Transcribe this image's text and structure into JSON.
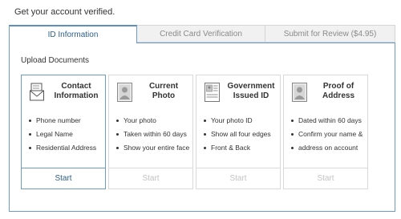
{
  "page_title": "Get your account verified.",
  "tabs": [
    {
      "label": "ID Information",
      "active": true
    },
    {
      "label": "Credit Card Verification",
      "active": false
    },
    {
      "label": "Submit for Review ($4.95)",
      "active": false
    }
  ],
  "section_label": "Upload Documents",
  "cards": [
    {
      "title": "Contact Information",
      "icon": "envelope-icon",
      "items": [
        "Phone number",
        "Legal Name",
        "Residential Address"
      ],
      "action": "Start",
      "enabled": true
    },
    {
      "title": "Current Photo",
      "icon": "portrait-photo-icon",
      "items": [
        "Your photo",
        "Taken within 60 days",
        "Show your entire face"
      ],
      "action": "Start",
      "enabled": false
    },
    {
      "title": "Government Issued ID",
      "icon": "id-card-icon",
      "items": [
        "Your photo ID",
        "Show all four edges",
        "Front & Back"
      ],
      "action": "Start",
      "enabled": false
    },
    {
      "title": "Proof of Address",
      "icon": "address-document-icon",
      "items": [
        "Dated within 60 days",
        "Confirm your name &",
        "address on account"
      ],
      "action": "Start",
      "enabled": false
    }
  ],
  "colors": {
    "accent": "#2b5f8c",
    "border_active": "#6e9ac7",
    "disabled_text": "#c2c2c2"
  }
}
